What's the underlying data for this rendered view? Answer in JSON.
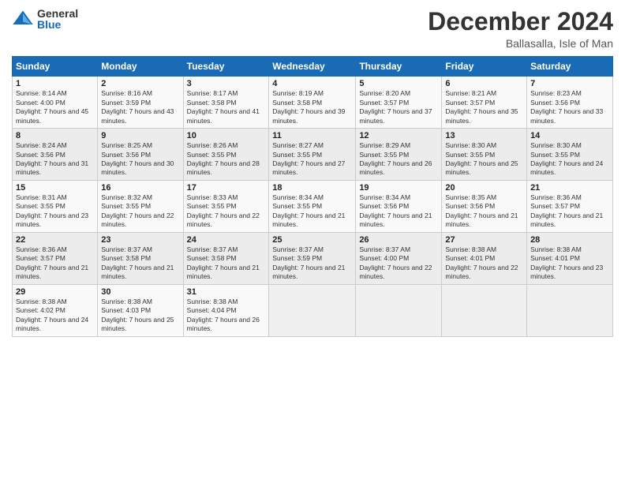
{
  "logo": {
    "general": "General",
    "blue": "Blue"
  },
  "header": {
    "title": "December 2024",
    "subtitle": "Ballasalla, Isle of Man"
  },
  "days_of_week": [
    "Sunday",
    "Monday",
    "Tuesday",
    "Wednesday",
    "Thursday",
    "Friday",
    "Saturday"
  ],
  "weeks": [
    [
      {
        "day": "1",
        "sunrise": "8:14 AM",
        "sunset": "4:00 PM",
        "daylight": "7 hours and 45 minutes."
      },
      {
        "day": "2",
        "sunrise": "8:16 AM",
        "sunset": "3:59 PM",
        "daylight": "7 hours and 43 minutes."
      },
      {
        "day": "3",
        "sunrise": "8:17 AM",
        "sunset": "3:58 PM",
        "daylight": "7 hours and 41 minutes."
      },
      {
        "day": "4",
        "sunrise": "8:19 AM",
        "sunset": "3:58 PM",
        "daylight": "7 hours and 39 minutes."
      },
      {
        "day": "5",
        "sunrise": "8:20 AM",
        "sunset": "3:57 PM",
        "daylight": "7 hours and 37 minutes."
      },
      {
        "day": "6",
        "sunrise": "8:21 AM",
        "sunset": "3:57 PM",
        "daylight": "7 hours and 35 minutes."
      },
      {
        "day": "7",
        "sunrise": "8:23 AM",
        "sunset": "3:56 PM",
        "daylight": "7 hours and 33 minutes."
      }
    ],
    [
      {
        "day": "8",
        "sunrise": "8:24 AM",
        "sunset": "3:56 PM",
        "daylight": "7 hours and 31 minutes."
      },
      {
        "day": "9",
        "sunrise": "8:25 AM",
        "sunset": "3:56 PM",
        "daylight": "7 hours and 30 minutes."
      },
      {
        "day": "10",
        "sunrise": "8:26 AM",
        "sunset": "3:55 PM",
        "daylight": "7 hours and 28 minutes."
      },
      {
        "day": "11",
        "sunrise": "8:27 AM",
        "sunset": "3:55 PM",
        "daylight": "7 hours and 27 minutes."
      },
      {
        "day": "12",
        "sunrise": "8:29 AM",
        "sunset": "3:55 PM",
        "daylight": "7 hours and 26 minutes."
      },
      {
        "day": "13",
        "sunrise": "8:30 AM",
        "sunset": "3:55 PM",
        "daylight": "7 hours and 25 minutes."
      },
      {
        "day": "14",
        "sunrise": "8:30 AM",
        "sunset": "3:55 PM",
        "daylight": "7 hours and 24 minutes."
      }
    ],
    [
      {
        "day": "15",
        "sunrise": "8:31 AM",
        "sunset": "3:55 PM",
        "daylight": "7 hours and 23 minutes."
      },
      {
        "day": "16",
        "sunrise": "8:32 AM",
        "sunset": "3:55 PM",
        "daylight": "7 hours and 22 minutes."
      },
      {
        "day": "17",
        "sunrise": "8:33 AM",
        "sunset": "3:55 PM",
        "daylight": "7 hours and 22 minutes."
      },
      {
        "day": "18",
        "sunrise": "8:34 AM",
        "sunset": "3:55 PM",
        "daylight": "7 hours and 21 minutes."
      },
      {
        "day": "19",
        "sunrise": "8:34 AM",
        "sunset": "3:56 PM",
        "daylight": "7 hours and 21 minutes."
      },
      {
        "day": "20",
        "sunrise": "8:35 AM",
        "sunset": "3:56 PM",
        "daylight": "7 hours and 21 minutes."
      },
      {
        "day": "21",
        "sunrise": "8:36 AM",
        "sunset": "3:57 PM",
        "daylight": "7 hours and 21 minutes."
      }
    ],
    [
      {
        "day": "22",
        "sunrise": "8:36 AM",
        "sunset": "3:57 PM",
        "daylight": "7 hours and 21 minutes."
      },
      {
        "day": "23",
        "sunrise": "8:37 AM",
        "sunset": "3:58 PM",
        "daylight": "7 hours and 21 minutes."
      },
      {
        "day": "24",
        "sunrise": "8:37 AM",
        "sunset": "3:58 PM",
        "daylight": "7 hours and 21 minutes."
      },
      {
        "day": "25",
        "sunrise": "8:37 AM",
        "sunset": "3:59 PM",
        "daylight": "7 hours and 21 minutes."
      },
      {
        "day": "26",
        "sunrise": "8:37 AM",
        "sunset": "4:00 PM",
        "daylight": "7 hours and 22 minutes."
      },
      {
        "day": "27",
        "sunrise": "8:38 AM",
        "sunset": "4:01 PM",
        "daylight": "7 hours and 22 minutes."
      },
      {
        "day": "28",
        "sunrise": "8:38 AM",
        "sunset": "4:01 PM",
        "daylight": "7 hours and 23 minutes."
      }
    ],
    [
      {
        "day": "29",
        "sunrise": "8:38 AM",
        "sunset": "4:02 PM",
        "daylight": "7 hours and 24 minutes."
      },
      {
        "day": "30",
        "sunrise": "8:38 AM",
        "sunset": "4:03 PM",
        "daylight": "7 hours and 25 minutes."
      },
      {
        "day": "31",
        "sunrise": "8:38 AM",
        "sunset": "4:04 PM",
        "daylight": "7 hours and 26 minutes."
      },
      null,
      null,
      null,
      null
    ]
  ]
}
